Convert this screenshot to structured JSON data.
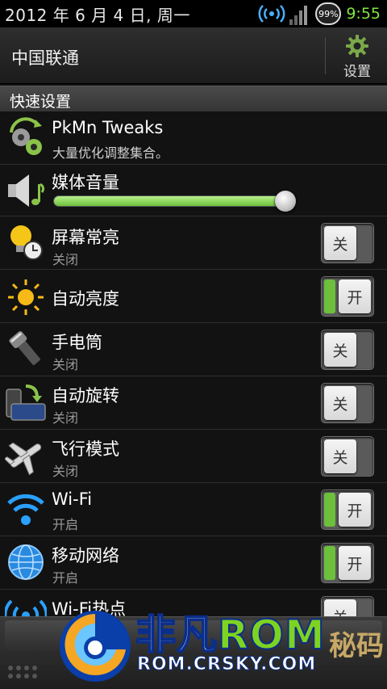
{
  "status_bar": {
    "date": "2012 年 6 月 4 日, 周一",
    "battery": "99%",
    "time": "9:55",
    "icons": [
      "wifi-icon",
      "signal-icon",
      "battery-icon"
    ]
  },
  "header": {
    "carrier": "中国联通",
    "settings_label": "设置",
    "settings_icon": "gear-icon"
  },
  "section": {
    "title": "快速设置"
  },
  "items": [
    {
      "id": "pkmn",
      "title": "PkMn Tweaks",
      "subtitle": "大量优化调整集合。",
      "icon": "gears-refresh-icon"
    },
    {
      "id": "media-volume",
      "title": "媒体音量",
      "icon": "speaker-icon",
      "volume_level": 0.98
    },
    {
      "id": "screen-on",
      "title": "屏幕常亮",
      "subtitle": "关闭",
      "icon": "bulb-clock-icon",
      "toggle": {
        "state": "off",
        "label": "关"
      }
    },
    {
      "id": "auto-brightness",
      "title": "自动亮度",
      "icon": "sun-icon",
      "toggle": {
        "state": "on",
        "label": "开"
      }
    },
    {
      "id": "flashlight",
      "title": "手电筒",
      "subtitle": "关闭",
      "icon": "flashlight-icon",
      "toggle": {
        "state": "off",
        "label": "关"
      }
    },
    {
      "id": "auto-rotate",
      "title": "自动旋转",
      "subtitle": "关闭",
      "icon": "rotate-icon",
      "toggle": {
        "state": "off",
        "label": "关"
      }
    },
    {
      "id": "airplane",
      "title": "飞行模式",
      "subtitle": "关闭",
      "icon": "airplane-icon",
      "toggle": {
        "state": "off",
        "label": "关"
      }
    },
    {
      "id": "wifi",
      "title": "Wi-Fi",
      "subtitle": "开启",
      "icon": "wifi-icon",
      "toggle": {
        "state": "on",
        "label": "开"
      }
    },
    {
      "id": "mobile-network",
      "title": "移动网络",
      "subtitle": "开启",
      "icon": "globe-icon",
      "toggle": {
        "state": "on",
        "label": "开"
      }
    },
    {
      "id": "wifi-hotspot",
      "title": "Wi-Fi热点",
      "icon": "hotspot-icon",
      "toggle": {
        "state": "off",
        "label": "关"
      }
    }
  ],
  "watermark": {
    "brand_part1": "非凡",
    "brand_part2": "ROM",
    "url": "ROM.CRSKY.COM",
    "side": "秘码"
  },
  "colors": {
    "accent_green": "#6cc03c",
    "clock_green": "#7fe640",
    "background": "#121212"
  }
}
